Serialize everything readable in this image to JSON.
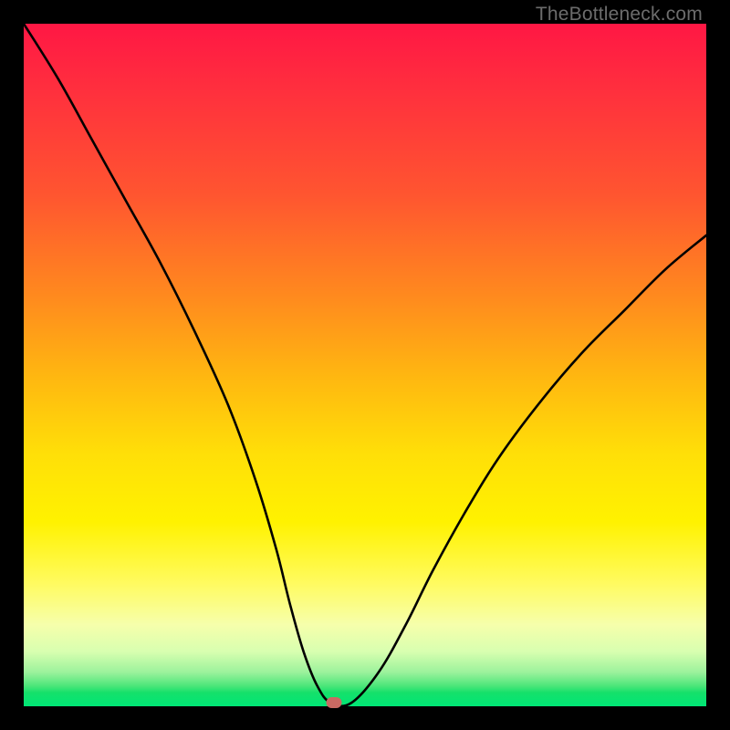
{
  "watermark": "TheBottleneck.com",
  "chart_data": {
    "type": "line",
    "title": "",
    "xlabel": "",
    "ylabel": "",
    "xlim": [
      0,
      100
    ],
    "ylim": [
      0,
      100
    ],
    "grid": false,
    "series": [
      {
        "name": "bottleneck-curve",
        "x": [
          0,
          5,
          10,
          15,
          20,
          25,
          30,
          34,
          37,
          39,
          41,
          43,
          45,
          48,
          52,
          56,
          60,
          65,
          70,
          76,
          82,
          88,
          94,
          100
        ],
        "y": [
          100,
          92,
          83,
          74,
          65,
          55,
          44,
          33,
          23,
          15,
          8,
          3,
          0.5,
          0.5,
          5,
          12,
          20,
          29,
          37,
          45,
          52,
          58,
          64,
          69
        ]
      }
    ],
    "marker": {
      "x": 45.5,
      "y": 0.5
    },
    "gradient_stops": [
      {
        "pos": 0,
        "color": "#ff1744"
      },
      {
        "pos": 50,
        "color": "#ffb810"
      },
      {
        "pos": 75,
        "color": "#fff200"
      },
      {
        "pos": 100,
        "color": "#00e676"
      }
    ]
  }
}
